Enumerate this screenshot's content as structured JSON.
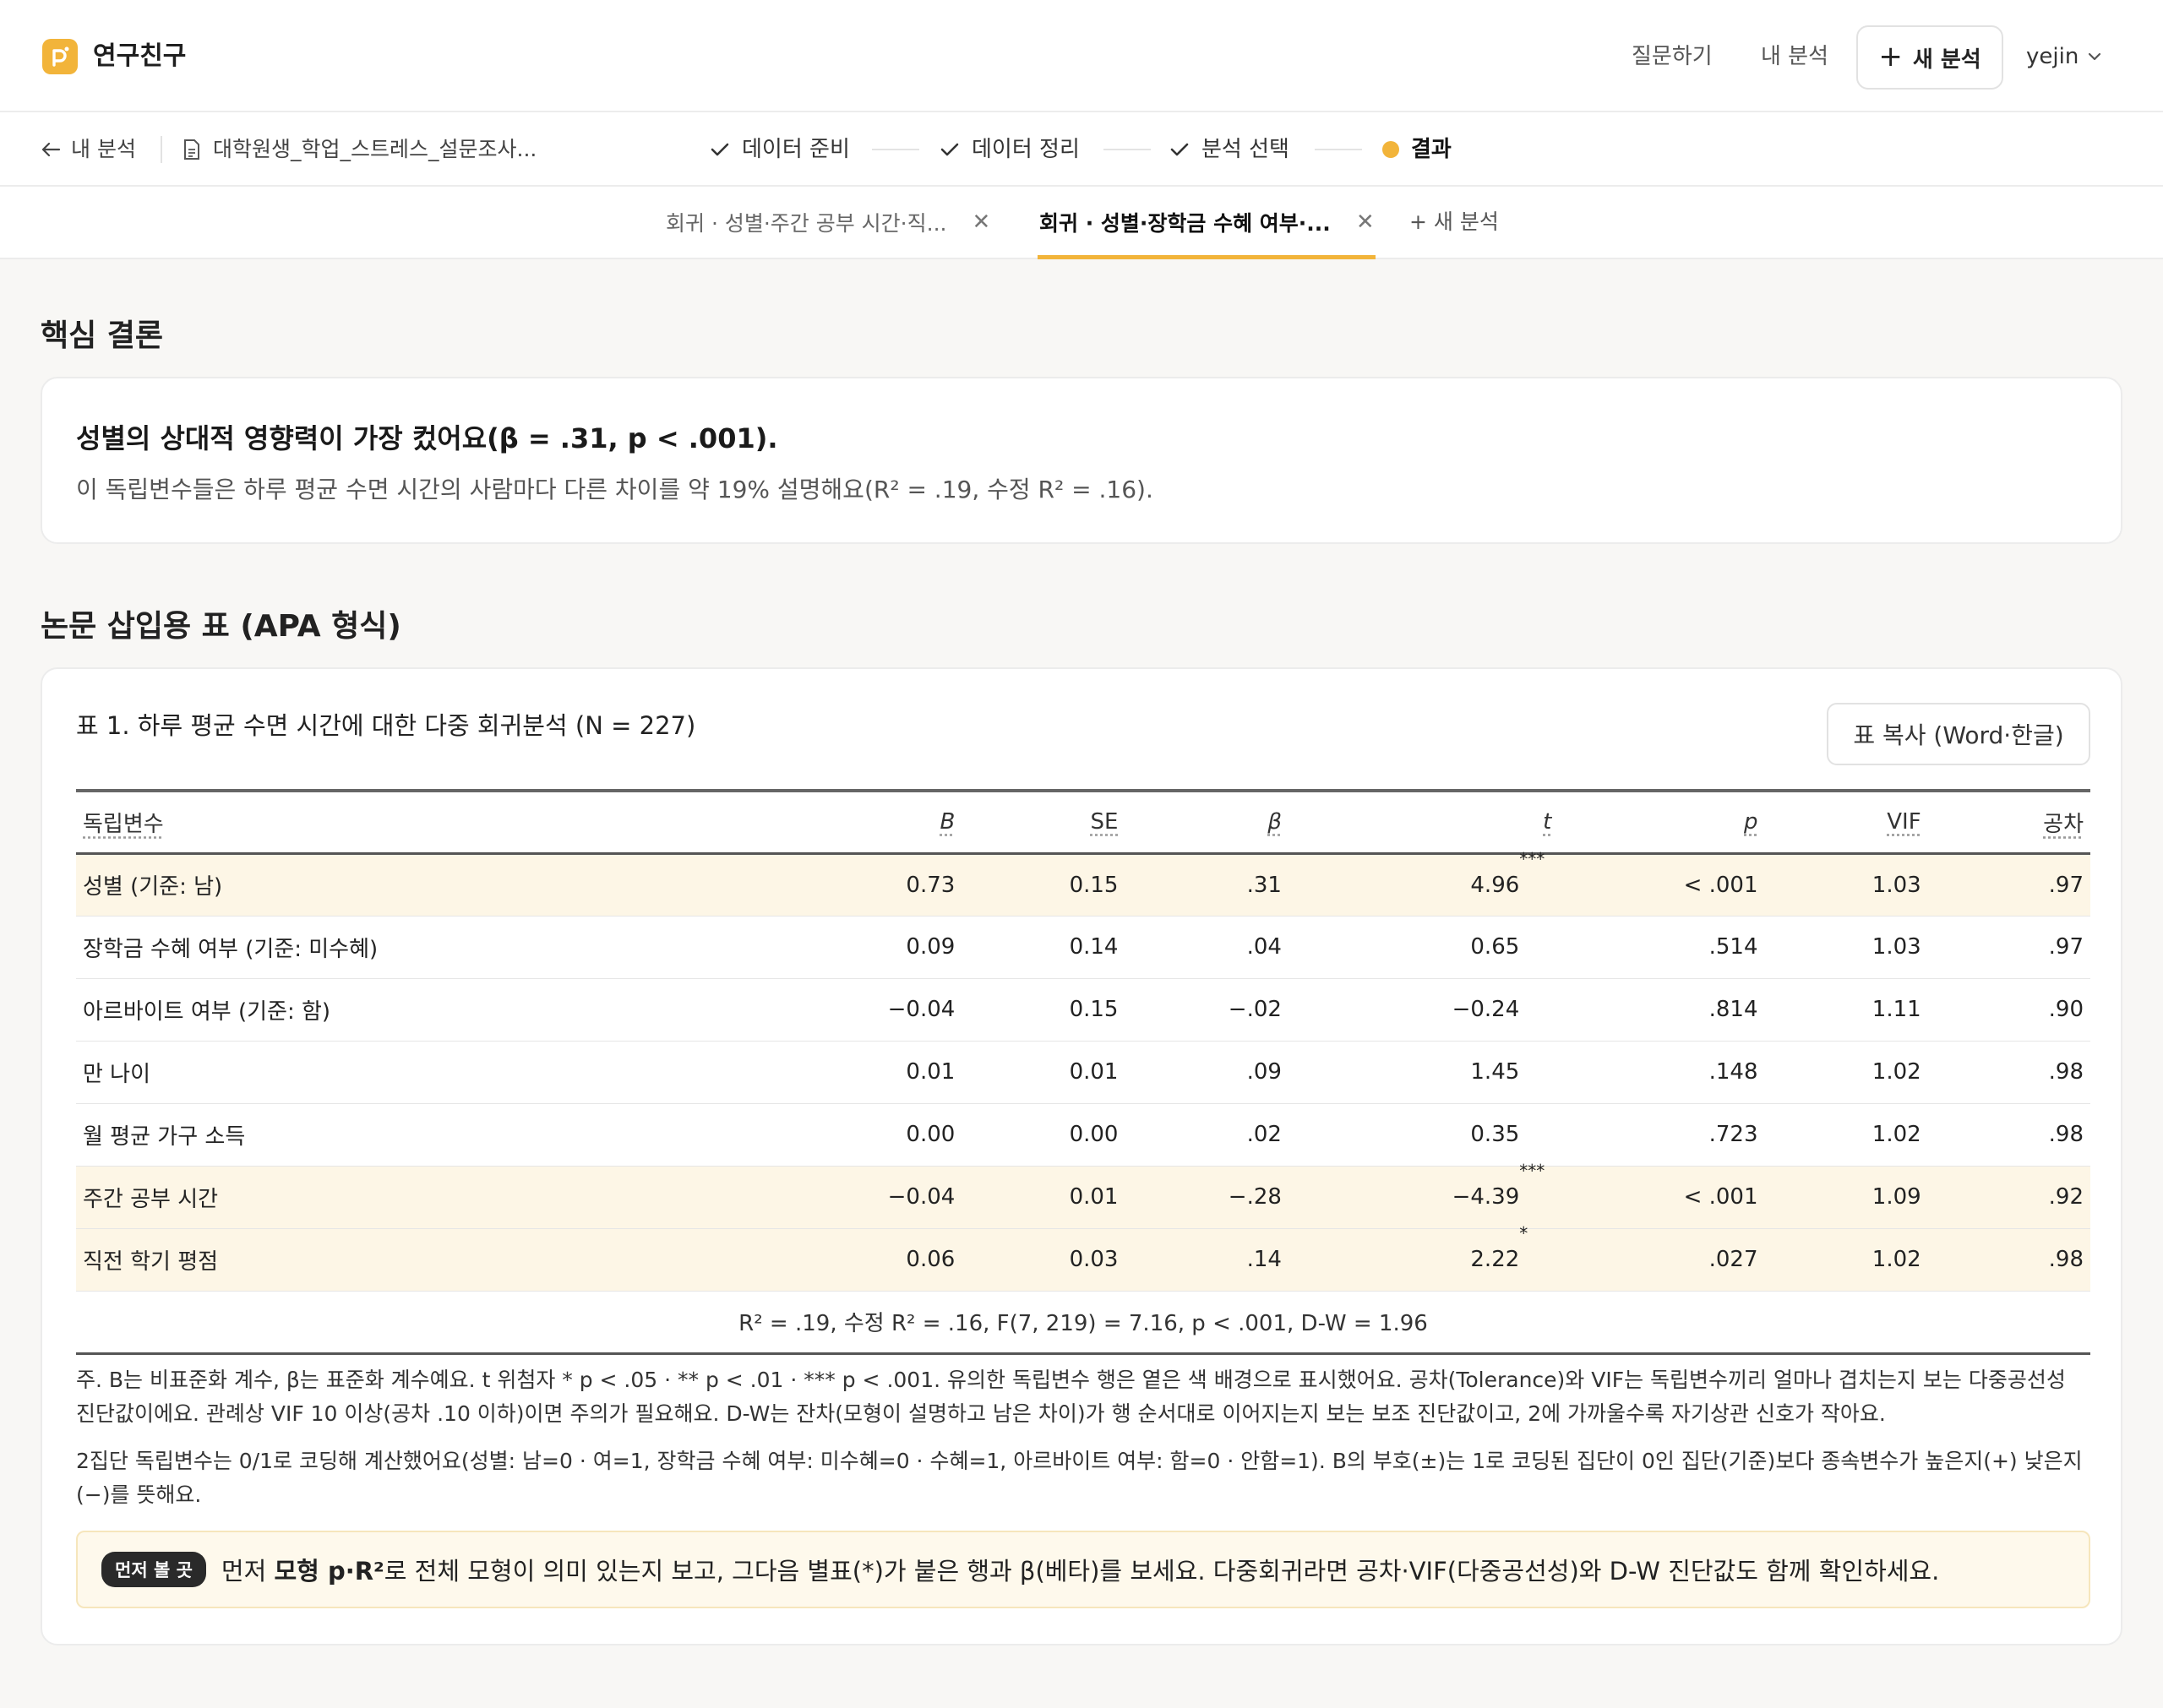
{
  "app": {
    "brand": "연구친구"
  },
  "topbar": {
    "ask": "질문하기",
    "my_analysis": "내 분석",
    "new_analysis": "새 분석",
    "user": "yejin"
  },
  "stepbar": {
    "back": "내 분석",
    "file": "대학원생_학업_스트레스_설문조사...",
    "steps": [
      {
        "label": "데이터 준비",
        "state": "done"
      },
      {
        "label": "데이터 정리",
        "state": "done"
      },
      {
        "label": "분석 선택",
        "state": "done"
      },
      {
        "label": "결과",
        "state": "current"
      }
    ]
  },
  "tabs": {
    "items": [
      {
        "label": "회귀 · 성별·주간 공부 시간·직...",
        "active": false
      },
      {
        "label": "회귀 · 성별·장학금 수혜 여부·...",
        "active": true
      }
    ],
    "add": "+ 새 분석"
  },
  "conclusion": {
    "title": "핵심 결론",
    "headline": "성별의 상대적 영향력이 가장 컸어요(β = .31, p < .001).",
    "sub": "이 독립변수들은 하루 평균 수면 시간의 사람마다 다른 차이를 약 19% 설명해요(R² = .19, 수정 R² = .16)."
  },
  "apa": {
    "title": "논문 삽입용 표 (APA 형식)",
    "table_title": "표 1. 하루 평균 수면 시간에 대한 다중 회귀분석 (N = 227)",
    "copy_button": "표 복사 (Word·한글)",
    "columns": [
      "독립변수",
      "B",
      "SE",
      "β",
      "t",
      "p",
      "VIF",
      "공차"
    ],
    "rows": [
      {
        "name": "성별 (기준: 남)",
        "B": "0.73",
        "SE": "0.15",
        "beta": ".31",
        "t": "4.96",
        "stars": "***",
        "p": "< .001",
        "VIF": "1.03",
        "tol": ".97",
        "sig": true
      },
      {
        "name": "장학금 수혜 여부 (기준: 미수혜)",
        "B": "0.09",
        "SE": "0.14",
        "beta": ".04",
        "t": "0.65",
        "stars": "",
        "p": ".514",
        "VIF": "1.03",
        "tol": ".97",
        "sig": false
      },
      {
        "name": "아르바이트 여부 (기준: 함)",
        "B": "−0.04",
        "SE": "0.15",
        "beta": "−.02",
        "t": "−0.24",
        "stars": "",
        "p": ".814",
        "VIF": "1.11",
        "tol": ".90",
        "sig": false
      },
      {
        "name": "만 나이",
        "B": "0.01",
        "SE": "0.01",
        "beta": ".09",
        "t": "1.45",
        "stars": "",
        "p": ".148",
        "VIF": "1.02",
        "tol": ".98",
        "sig": false
      },
      {
        "name": "월 평균 가구 소득",
        "B": "0.00",
        "SE": "0.00",
        "beta": ".02",
        "t": "0.35",
        "stars": "",
        "p": ".723",
        "VIF": "1.02",
        "tol": ".98",
        "sig": false
      },
      {
        "name": "주간 공부 시간",
        "B": "−0.04",
        "SE": "0.01",
        "beta": "−.28",
        "t": "−4.39",
        "stars": "***",
        "p": "< .001",
        "VIF": "1.09",
        "tol": ".92",
        "sig": true
      },
      {
        "name": "직전 학기 평점",
        "B": "0.06",
        "SE": "0.03",
        "beta": ".14",
        "t": "2.22",
        "stars": "*",
        "p": ".027",
        "VIF": "1.02",
        "tol": ".98",
        "sig": true
      }
    ],
    "fit": "R² = .19, 수정 R² = .16, F(7, 219) = 7.16, p < .001, D-W = 1.96",
    "note1": "주. B는 비표준화 계수, β는 표준화 계수예요. t 위첨자 * p < .05 · ** p < .01 · *** p < .001. 유의한 독립변수 행은 옅은 색 배경으로 표시했어요. 공차(Tolerance)와 VIF는 독립변수끼리 얼마나 겹치는지 보는 다중공선성 진단값이에요. 관례상 VIF 10 이상(공차 .10 이하)이면 주의가 필요해요. D-W는 잔차(모형이 설명하고 남은 차이)가 행 순서대로 이어지는지 보는 보조 진단값이고, 2에 가까울수록 자기상관 신호가 작아요.",
    "note2": "2집단 독립변수는 0/1로 코딩해 계산했어요(성별: 남=0 · 여=1, 장학금 수혜 여부: 미수혜=0 · 수혜=1, 아르바이트 여부: 함=0 · 안함=1). B의 부호(±)는 1로 코딩된 집단이 0인 집단(기준)보다 종속변수가 높은지(+) 낮은지(−)를 뜻해요.",
    "tip_badge": "먼저 볼 곳",
    "tip_pre": "먼저 ",
    "tip_bold": "모형 p·R²",
    "tip_post": "로 전체 모형이 의미 있는지 보고, 그다음 별표(*)가 붙은 행과 β(베타)를 보세요. 다중회귀라면 공차·VIF(다중공선성)와 D-W 진단값도 함께 확인하세요."
  },
  "colors": {
    "accent": "#f2b43a",
    "highlight_row": "#fdf6e6"
  }
}
